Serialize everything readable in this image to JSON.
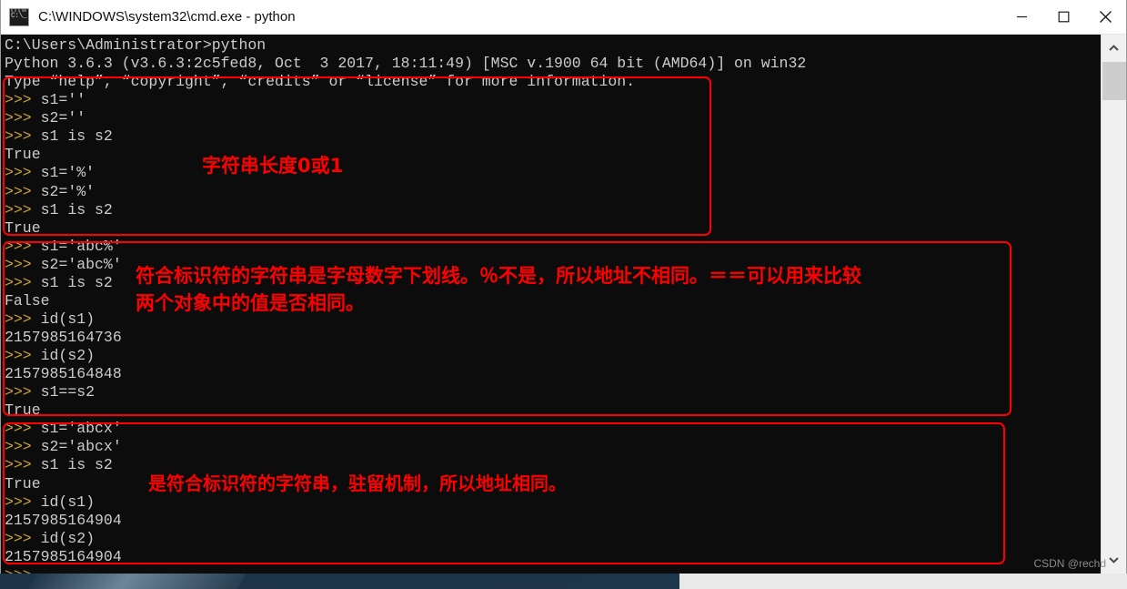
{
  "window": {
    "title": "C:\\WINDOWS\\system32\\cmd.exe - python",
    "icon": "cmd-icon",
    "controls": {
      "minimize": "minimize-button",
      "maximize": "maximize-button",
      "close": "close-button"
    }
  },
  "console": {
    "lines": [
      {
        "prompt": "",
        "text": "C:\\Users\\Administrator>python"
      },
      {
        "prompt": "",
        "text": "Python 3.6.3 (v3.6.3:2c5fed8, Oct  3 2017, 18:11:49) [MSC v.1900 64 bit (AMD64)] on win32"
      },
      {
        "prompt": "",
        "text": "Type “help”, “copyright”, “credits” or “license” for more information."
      },
      {
        "prompt": ">>>",
        "text": " s1=''"
      },
      {
        "prompt": ">>>",
        "text": " s2=''"
      },
      {
        "prompt": ">>>",
        "text": " s1 is s2"
      },
      {
        "prompt": "",
        "text": "True"
      },
      {
        "prompt": ">>>",
        "text": " s1='%'"
      },
      {
        "prompt": ">>>",
        "text": " s2='%'"
      },
      {
        "prompt": ">>>",
        "text": " s1 is s2"
      },
      {
        "prompt": "",
        "text": "True"
      },
      {
        "prompt": ">>>",
        "text": " s1='abc%'"
      },
      {
        "prompt": ">>>",
        "text": " s2='abc%'"
      },
      {
        "prompt": ">>>",
        "text": " s1 is s2"
      },
      {
        "prompt": "",
        "text": "False"
      },
      {
        "prompt": ">>>",
        "text": " id(s1)"
      },
      {
        "prompt": "",
        "text": "2157985164736"
      },
      {
        "prompt": ">>>",
        "text": " id(s2)"
      },
      {
        "prompt": "",
        "text": "2157985164848"
      },
      {
        "prompt": ">>>",
        "text": " s1==s2"
      },
      {
        "prompt": "",
        "text": "True"
      },
      {
        "prompt": ">>>",
        "text": " s1='abcx'"
      },
      {
        "prompt": ">>>",
        "text": " s2='abcx'"
      },
      {
        "prompt": ">>>",
        "text": " s1 is s2"
      },
      {
        "prompt": "",
        "text": "True"
      },
      {
        "prompt": ">>>",
        "text": " id(s1)"
      },
      {
        "prompt": "",
        "text": "2157985164904"
      },
      {
        "prompt": ">>>",
        "text": " id(s2)"
      },
      {
        "prompt": "",
        "text": "2157985164904"
      },
      {
        "prompt": ">>>",
        "text": ""
      }
    ]
  },
  "annotations": {
    "color": "#ff0000",
    "note1": "字符串长度0或1",
    "note2": "符合标识符的字符串是字母数字下划线。％不是，所以地址不相同。＝＝可以用来比较\n两个对象中的值是否相同。",
    "note3": "是符合标识符的字符串，驻留机制，所以地址相同。"
  },
  "scrollbar": {
    "up_arrow": "chevron-up-icon",
    "down_arrow": "chevron-down-icon"
  },
  "watermark": "CSDN @rechd"
}
